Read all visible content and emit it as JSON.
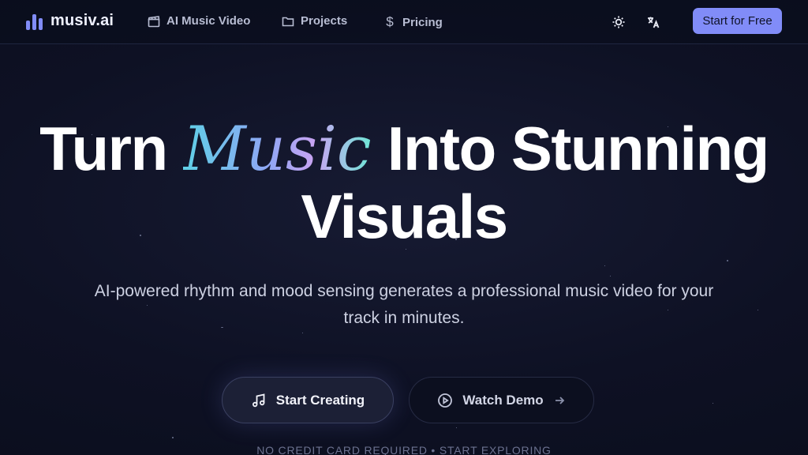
{
  "brand": {
    "name": "musiv.ai"
  },
  "nav": {
    "links": [
      {
        "label": "AI Music Video",
        "icon": "clapperboard-icon"
      },
      {
        "label": "Projects",
        "icon": "folder-icon"
      },
      {
        "label": "Pricing",
        "icon": "dollar-icon"
      }
    ],
    "theme_icon": "sun-icon",
    "language_icon": "translate-icon",
    "cta_label": "Start for Free"
  },
  "hero": {
    "title_part1": "Turn ",
    "title_accent": "Music",
    "title_part2": " Into Stunning",
    "title_line2": "Visuals",
    "subtitle": "AI-powered rhythm and mood sensing generates a professional music video for your track in minutes.",
    "primary_button": {
      "label": "Start Creating",
      "icon": "music-note-icon"
    },
    "secondary_button": {
      "label": "Watch Demo",
      "icon": "play-circle-icon",
      "trailing_icon": "arrow-right-icon"
    },
    "footnote": "NO CREDIT CARD REQUIRED  •  START EXPLORING"
  },
  "colors": {
    "accent": "#818cf8",
    "background": "#0e1124",
    "text": "#ffffff",
    "muted": "#b8bdd3"
  }
}
